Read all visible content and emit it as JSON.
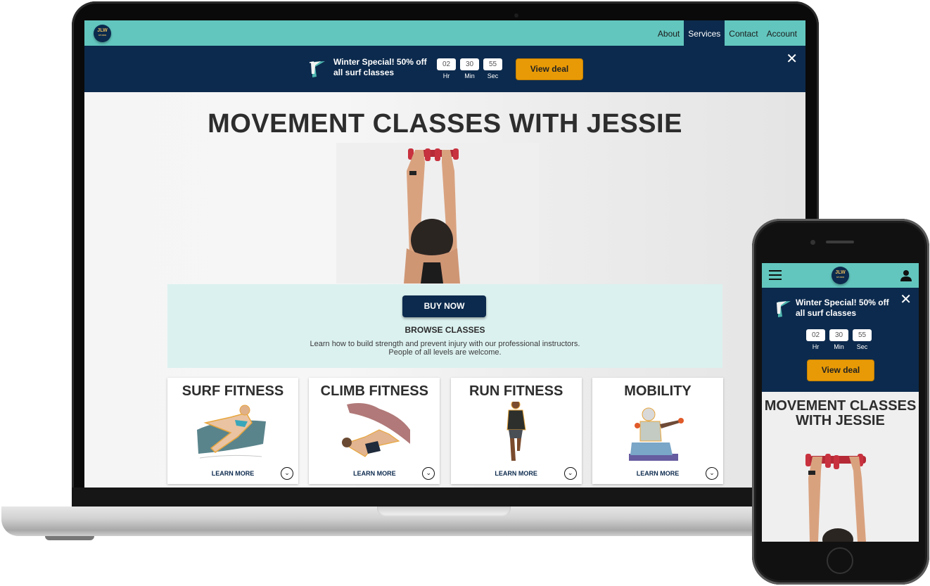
{
  "brand": {
    "logo_text": "JLW",
    "logo_subtext": "STUDIO",
    "primary_color": "#0c2a4d",
    "accent_color": "#62c6be",
    "deal_color": "#e89a06",
    "panel_color": "#dbf1ef"
  },
  "nav": {
    "items": [
      {
        "label": "About",
        "active": false
      },
      {
        "label": "Services",
        "active": true
      },
      {
        "label": "Contact",
        "active": false
      },
      {
        "label": "Account",
        "active": false
      }
    ]
  },
  "promo": {
    "icon": "surfer-icon",
    "text": "Winter Special! 50% off all surf classes",
    "timer": [
      {
        "value": "02",
        "label": "Hr"
      },
      {
        "value": "30",
        "label": "Min"
      },
      {
        "value": "55",
        "label": "Sec"
      }
    ],
    "cta_label": "View deal",
    "close_icon": "close-icon"
  },
  "hero": {
    "title": "MOVEMENT CLASSES WITH JESSIE",
    "mobile_title": "MOVEMENT CLASSES WITH JESSIE",
    "image_alt": "Person holding red dumbbells against a white wall"
  },
  "browse": {
    "button_label": "BUY NOW",
    "heading": "BROWSE CLASSES",
    "description": "Learn how to build strength and prevent injury with our professional instructors. People of all levels are welcome."
  },
  "classes": [
    {
      "title": "SURF FITNESS",
      "link_label": "LEARN MORE",
      "illustration": "surfer-illustration"
    },
    {
      "title": "CLIMB FITNESS",
      "link_label": "LEARN MORE",
      "illustration": "climber-illustration"
    },
    {
      "title": "RUN FITNESS",
      "link_label": "LEARN MORE",
      "illustration": "runner-illustration"
    },
    {
      "title": "MOBILITY",
      "link_label": "LEARN MORE",
      "illustration": "mobility-illustration"
    }
  ],
  "mobile": {
    "menu_icon": "hamburger-icon",
    "account_icon": "user-icon"
  }
}
